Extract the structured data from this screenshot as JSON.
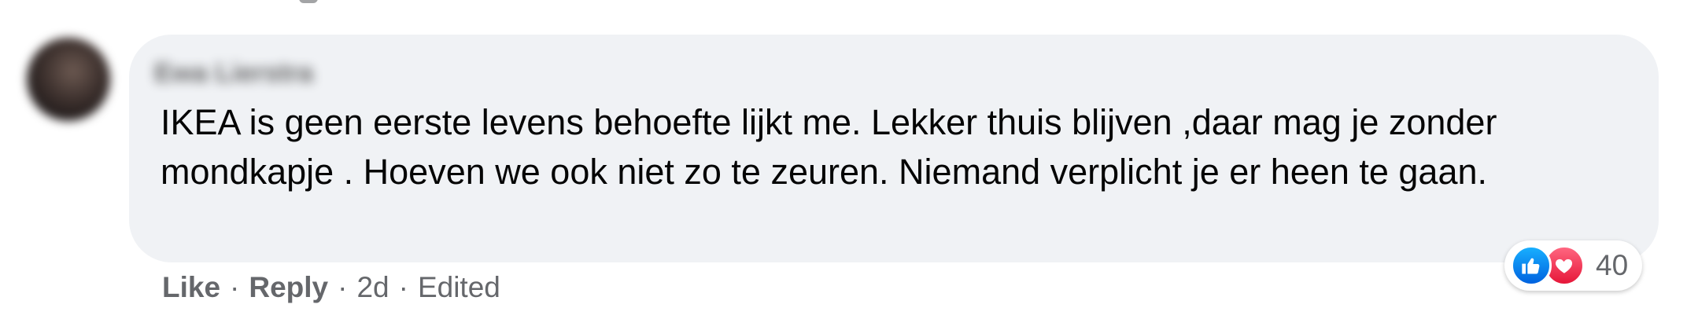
{
  "comment": {
    "author": "Ewa Lierstra",
    "text": "IKEA is geen eerste levens behoefte lijkt me. Lekker thuis blijven ,daar mag je zonder mondkapje . Hoeven we ook niet zo te zeuren. Niemand verplicht je er heen te gaan.",
    "actions": {
      "like_label": "Like",
      "reply_label": "Reply",
      "separator": "·",
      "time": "2d",
      "edited": "Edited"
    },
    "reactions": {
      "icons": [
        "like-icon",
        "love-icon"
      ],
      "count": "40"
    }
  },
  "colors": {
    "bubble_bg": "#f0f2f5",
    "text": "#050505",
    "secondary": "#65676b",
    "like_blue": "#1877f2",
    "love_red": "#f33e58"
  }
}
